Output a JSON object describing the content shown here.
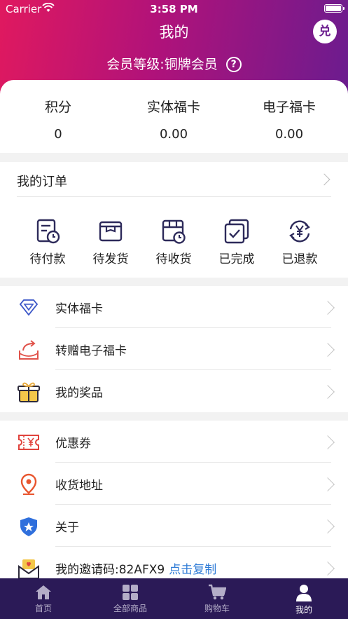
{
  "status": {
    "carrier": "Carrier",
    "time": "3:58 PM"
  },
  "header": {
    "title": "我的",
    "redeem_icon_text": "兑",
    "member_level": "会员等级:铜牌会员",
    "help_icon_text": "?"
  },
  "stats": [
    {
      "label": "积分",
      "value": "0"
    },
    {
      "label": "实体福卡",
      "value": "0.00"
    },
    {
      "label": "电子福卡",
      "value": "0.00"
    }
  ],
  "orders": {
    "title": "我的订单",
    "items": [
      {
        "label": "待付款",
        "icon": "pending-payment-icon"
      },
      {
        "label": "待发货",
        "icon": "pending-shipment-icon"
      },
      {
        "label": "待收货",
        "icon": "pending-receipt-icon"
      },
      {
        "label": "已完成",
        "icon": "completed-icon"
      },
      {
        "label": "已退款",
        "icon": "refunded-icon"
      }
    ]
  },
  "menu_group1": [
    {
      "label": "实体福卡",
      "icon": "diamond-icon"
    },
    {
      "label": "转赠电子福卡",
      "icon": "transfer-icon"
    },
    {
      "label": "我的奖品",
      "icon": "gift-icon"
    }
  ],
  "menu_group2": [
    {
      "label": "优惠券",
      "icon": "coupon-icon"
    },
    {
      "label": "收货地址",
      "icon": "location-pin-icon"
    },
    {
      "label": "关于",
      "icon": "shield-star-icon"
    },
    {
      "label": "我的邀请码:82AFX9",
      "icon": "invite-envelope-icon",
      "action": "点击复制"
    }
  ],
  "tabs": [
    {
      "label": "首页",
      "icon": "home-icon"
    },
    {
      "label": "全部商品",
      "icon": "grid-icon"
    },
    {
      "label": "购物车",
      "icon": "cart-icon"
    },
    {
      "label": "我的",
      "icon": "user-icon",
      "active": true
    }
  ],
  "colors": {
    "gradient_start": "#e0195f",
    "gradient_end": "#6a1c8f",
    "tabbar_bg": "#2b1a57",
    "order_icon": "#2d2a5a",
    "link": "#2f7bd6"
  }
}
